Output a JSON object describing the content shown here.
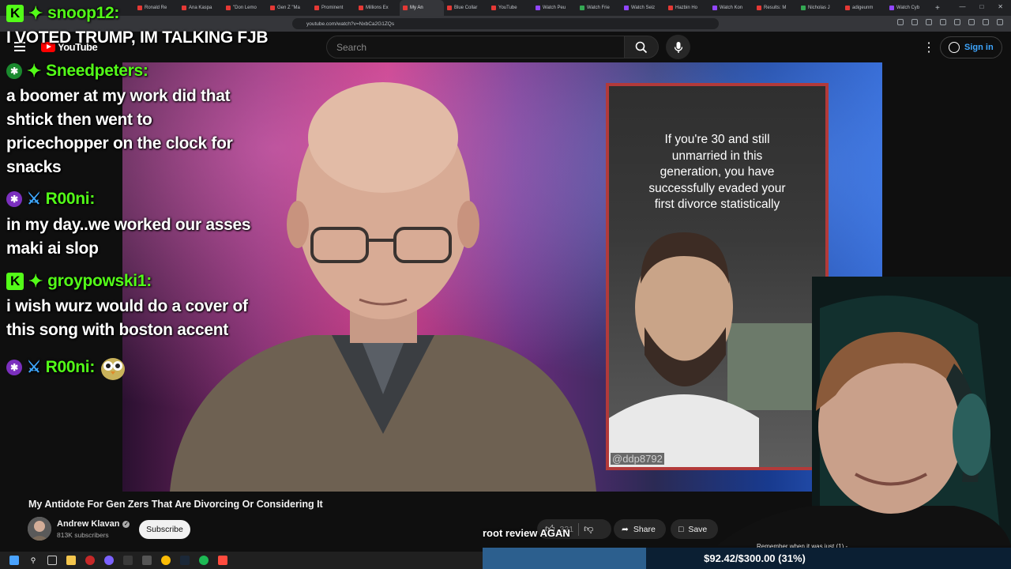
{
  "browser": {
    "tabs": [
      {
        "label": "Ronald Re",
        "fav": "red"
      },
      {
        "label": "Ana Kaspa",
        "fav": "red"
      },
      {
        "label": "\"Don Lemo",
        "fav": "red"
      },
      {
        "label": "Gen Z \"Ma",
        "fav": "red"
      },
      {
        "label": "Prominent",
        "fav": "red"
      },
      {
        "label": "Millions Ex",
        "fav": "red"
      },
      {
        "label": "My An",
        "fav": "red",
        "active": true
      },
      {
        "label": "Blue Collar",
        "fav": "red"
      },
      {
        "label": "YouTube",
        "fav": "red"
      },
      {
        "label": "Watch Peu",
        "fav": "purple"
      },
      {
        "label": "Watch Frie",
        "fav": "green"
      },
      {
        "label": "Watch Seiz",
        "fav": "purple"
      },
      {
        "label": "Hazbin Ho",
        "fav": "red"
      },
      {
        "label": "Watch Kon",
        "fav": "purple"
      },
      {
        "label": "Results: M",
        "fav": "red"
      },
      {
        "label": "Nicholas J",
        "fav": "green"
      },
      {
        "label": "adigeunm",
        "fav": "red"
      },
      {
        "label": "Watch Cyb",
        "fav": "purple"
      }
    ],
    "new_tab": "+",
    "url": "youtube.com/watch?v=NxbCa2G1ZQs"
  },
  "youtube": {
    "logo_text": "YouTube",
    "search_placeholder": "Search",
    "signin_label": "Sign in"
  },
  "chat": [
    {
      "badge": "kick",
      "icon": "gem",
      "user": "snoop12:",
      "color": "green",
      "lines": []
    },
    {
      "badge": "",
      "icon": "",
      "user": "",
      "color": "",
      "lines": [
        "I VOTED TRUMP, IM TALKING FJB"
      ]
    },
    {
      "badge": "star-green",
      "icon": "gem",
      "user": "Sneedpeters:",
      "color": "green",
      "lines": [
        "a boomer at my work did that",
        "shtick then went to",
        "pricechopper on the clock for",
        "snacks"
      ]
    },
    {
      "badge": "star-purple",
      "icon": "sword",
      "user": "R00ni:",
      "color": "green",
      "lines": [
        "in my day..we worked our asses",
        "maki ai slop"
      ]
    },
    {
      "badge": "kick",
      "icon": "gem",
      "user": "groypowski1:",
      "color": "green",
      "lines": [
        "i wish wurz would do a cover of",
        "this song with boston accent"
      ]
    },
    {
      "badge": "star-purple",
      "icon": "sword",
      "user": "R00ni:",
      "color": "green",
      "lines": []
    }
  ],
  "video": {
    "short_overlay_text": [
      "If you're 30 and still",
      "unmarried in this",
      "generation, you have",
      "successfully evaded your",
      "first divorce statistically"
    ],
    "short_handle": "@ddp8792",
    "title": "My Antidote For Gen Zers That Are Divorcing Or Considering It",
    "channel_name": "Andrew Klavan",
    "subscribers": "813K subscribers",
    "subscribe_label": "Subscribe",
    "like_count": "321",
    "share_label": "Share",
    "save_label": "Save"
  },
  "overlay": {
    "caption": "root review AGAN",
    "goal_text": "$92.42/$300.00 (31%)",
    "goal_fraction": 0.31,
    "ticker": "Remember when it was just (1) -"
  },
  "colors": {
    "kick_green": "#53fc18",
    "yt_red": "#ff0000",
    "short_border": "#b23a3a",
    "goal_fill": "#2c5f8e"
  }
}
